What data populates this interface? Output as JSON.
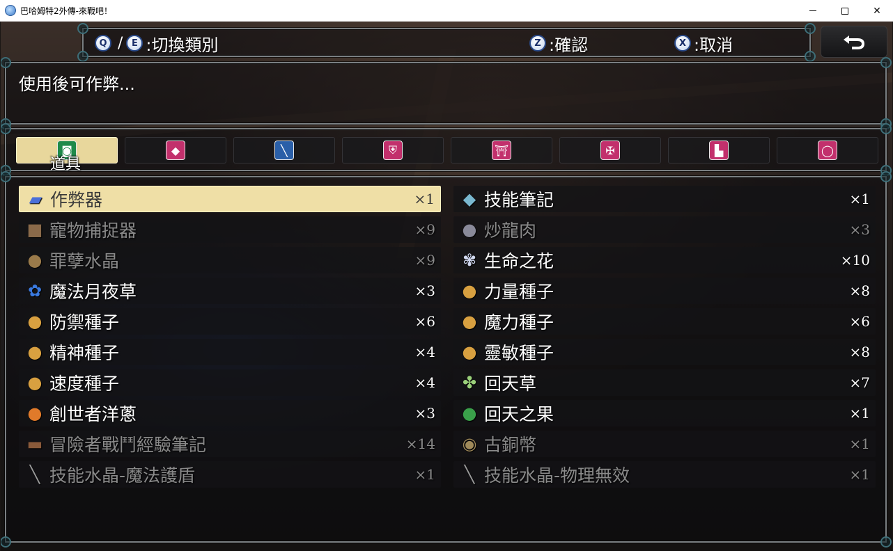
{
  "window": {
    "title": "巴哈姆特2外傳-來戰吧！",
    "minimize_icon": "minimize-icon",
    "maximize_icon": "maximize-icon",
    "close_glyph": "✕"
  },
  "help": {
    "switch": {
      "key1": "Q",
      "slash": "/",
      "key2": "E",
      "label": ":切換類別"
    },
    "confirm": {
      "key": "Z",
      "label": ":確認"
    },
    "cancel": {
      "key": "X",
      "label": ":取消"
    }
  },
  "description": "使用後可作弊...",
  "categories": [
    {
      "label": "道具",
      "icon": "item-bag-icon",
      "glyph": "◙",
      "color": "#1f8a4a",
      "active": true
    },
    {
      "label": "",
      "icon": "monster-icon",
      "glyph": "◆",
      "color": "#c2306c",
      "active": false
    },
    {
      "label": "",
      "icon": "sword-icon",
      "glyph": "╲",
      "color": "#2a5fa8",
      "active": false
    },
    {
      "label": "",
      "icon": "shield-icon",
      "glyph": "⛨",
      "color": "#c2306c",
      "active": false
    },
    {
      "label": "",
      "icon": "helmet-icon",
      "glyph": "⛩",
      "color": "#c2306c",
      "active": false
    },
    {
      "label": "",
      "icon": "armor-icon",
      "glyph": "✠",
      "color": "#c2306c",
      "active": false
    },
    {
      "label": "",
      "icon": "boots-icon",
      "glyph": "▙",
      "color": "#c2306c",
      "active": false
    },
    {
      "label": "",
      "icon": "ring-icon",
      "glyph": "◯",
      "color": "#c2306c",
      "active": false
    }
  ],
  "items_left": [
    {
      "name": "作弊器",
      "count": "×1",
      "icon": "cheat-device-icon",
      "glyph": "▰",
      "color": "#4a6fd8",
      "state": "selected"
    },
    {
      "name": "寵物捕捉器",
      "count": "×9",
      "icon": "pet-capture-box-icon",
      "glyph": "■",
      "color": "#8a6a4a",
      "state": "disabled"
    },
    {
      "name": "罪孽水晶",
      "count": "×9",
      "icon": "money-bag-icon",
      "glyph": "●",
      "color": "#9a7a4a",
      "state": "disabled"
    },
    {
      "name": "魔法月夜草",
      "count": "×3",
      "icon": "blue-herb-icon",
      "glyph": "✿",
      "color": "#3a7ae0",
      "state": "normal"
    },
    {
      "name": "防禦種子",
      "count": "×6",
      "icon": "seed-icon",
      "glyph": "●",
      "color": "#d8a040",
      "state": "normal"
    },
    {
      "name": "精神種子",
      "count": "×4",
      "icon": "seed-icon",
      "glyph": "●",
      "color": "#d8a040",
      "state": "normal"
    },
    {
      "name": "速度種子",
      "count": "×4",
      "icon": "seed-icon",
      "glyph": "●",
      "color": "#d8a040",
      "state": "normal"
    },
    {
      "name": "創世者洋蔥",
      "count": "×3",
      "icon": "onion-icon",
      "glyph": "●",
      "color": "#e07a2a",
      "state": "normal"
    },
    {
      "name": "冒險者戰鬥經驗筆記",
      "count": "×14",
      "icon": "notebook-icon",
      "glyph": "▬",
      "color": "#8a5a3a",
      "state": "disabled"
    },
    {
      "name": "技能水晶-魔法護盾",
      "count": "×1",
      "icon": "crystal-icon",
      "glyph": "╲",
      "color": "#9a9a9a",
      "state": "disabled"
    }
  ],
  "items_right": [
    {
      "name": "技能筆記",
      "count": "×1",
      "icon": "skill-book-icon",
      "glyph": "◆",
      "color": "#7ab8d0",
      "state": "normal"
    },
    {
      "name": "炒龍肉",
      "count": "×3",
      "icon": "pot-icon",
      "glyph": "●",
      "color": "#8a8a9a",
      "state": "disabled"
    },
    {
      "name": "生命之花",
      "count": "×10",
      "icon": "flower-wand-icon",
      "glyph": "✾",
      "color": "#d0d8f0",
      "state": "normal"
    },
    {
      "name": "力量種子",
      "count": "×8",
      "icon": "seed-icon",
      "glyph": "●",
      "color": "#d8a040",
      "state": "normal"
    },
    {
      "name": "魔力種子",
      "count": "×6",
      "icon": "seed-icon",
      "glyph": "●",
      "color": "#d8a040",
      "state": "normal"
    },
    {
      "name": "靈敏種子",
      "count": "×8",
      "icon": "seed-icon",
      "glyph": "●",
      "color": "#d8a040",
      "state": "normal"
    },
    {
      "name": "回天草",
      "count": "×7",
      "icon": "herb-icon",
      "glyph": "✤",
      "color": "#9ad07a",
      "state": "normal"
    },
    {
      "name": "回天之果",
      "count": "×1",
      "icon": "green-fruit-icon",
      "glyph": "●",
      "color": "#3aa04a",
      "state": "normal"
    },
    {
      "name": "古銅幣",
      "count": "×1",
      "icon": "coin-icon",
      "glyph": "◉",
      "color": "#a08a5a",
      "state": "disabled"
    },
    {
      "name": "技能水晶-物理無效",
      "count": "×1",
      "icon": "crystal-icon",
      "glyph": "╲",
      "color": "#9a9a9a",
      "state": "disabled"
    }
  ]
}
